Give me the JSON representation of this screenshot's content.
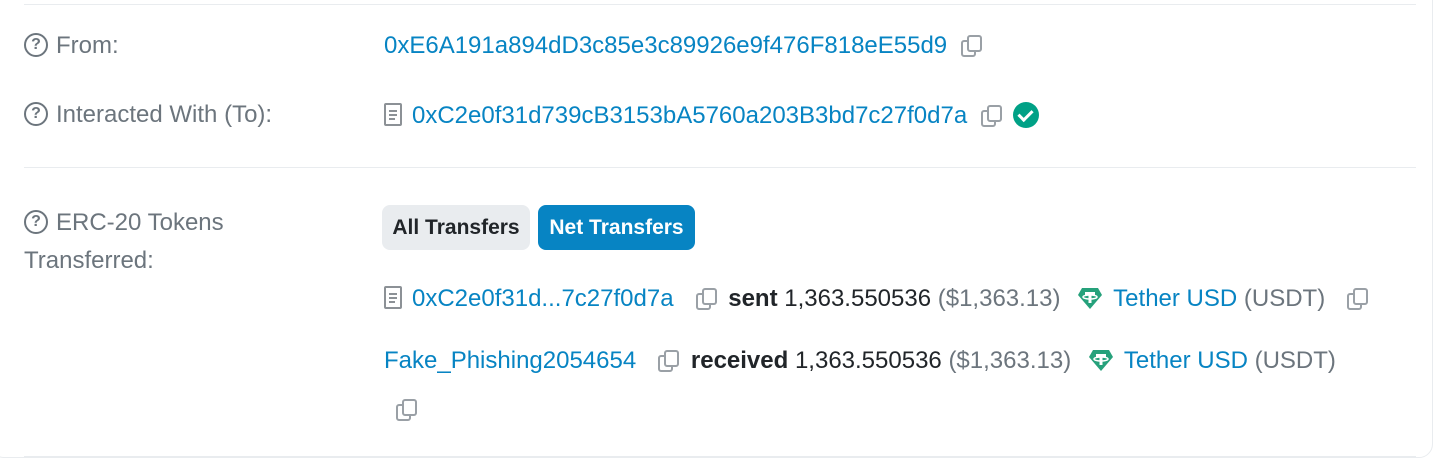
{
  "from": {
    "label": "From:",
    "address": "0xE6A191a894dD3c85e3c89926e9f476F818eE55d9"
  },
  "interacted": {
    "label": "Interacted With (To):",
    "address": "0xC2e0f31d739cB3153bA5760a203B3bd7c27f0d7a"
  },
  "erc20": {
    "label_line1": "ERC-20 Tokens",
    "label_line2": "Transferred:",
    "tabs": {
      "all": "All Transfers",
      "net": "Net Transfers"
    },
    "transfers": [
      {
        "party": "0xC2e0f31d...7c27f0d7a",
        "action": "sent",
        "amount": "1,363.550536",
        "usd": "($1,363.13)",
        "token_name": "Tether USD",
        "token_symbol": "(USDT)"
      },
      {
        "party": "Fake_Phishing2054654",
        "action": "received",
        "amount": "1,363.550536",
        "usd": "($1,363.13)",
        "token_name": "Tether USD",
        "token_symbol": "(USDT)"
      }
    ]
  },
  "icons": {
    "help": "question-circle-icon",
    "copy": "copy-icon",
    "contract": "document-icon",
    "verified": "check-circle-icon",
    "token": "tether-icon"
  },
  "colors": {
    "link": "#0784c3",
    "muted": "#6c757d",
    "verified": "#00a186",
    "tether": "#26a17b",
    "tab_active": "#0784c3",
    "tab_inactive": "#e9ecef"
  }
}
